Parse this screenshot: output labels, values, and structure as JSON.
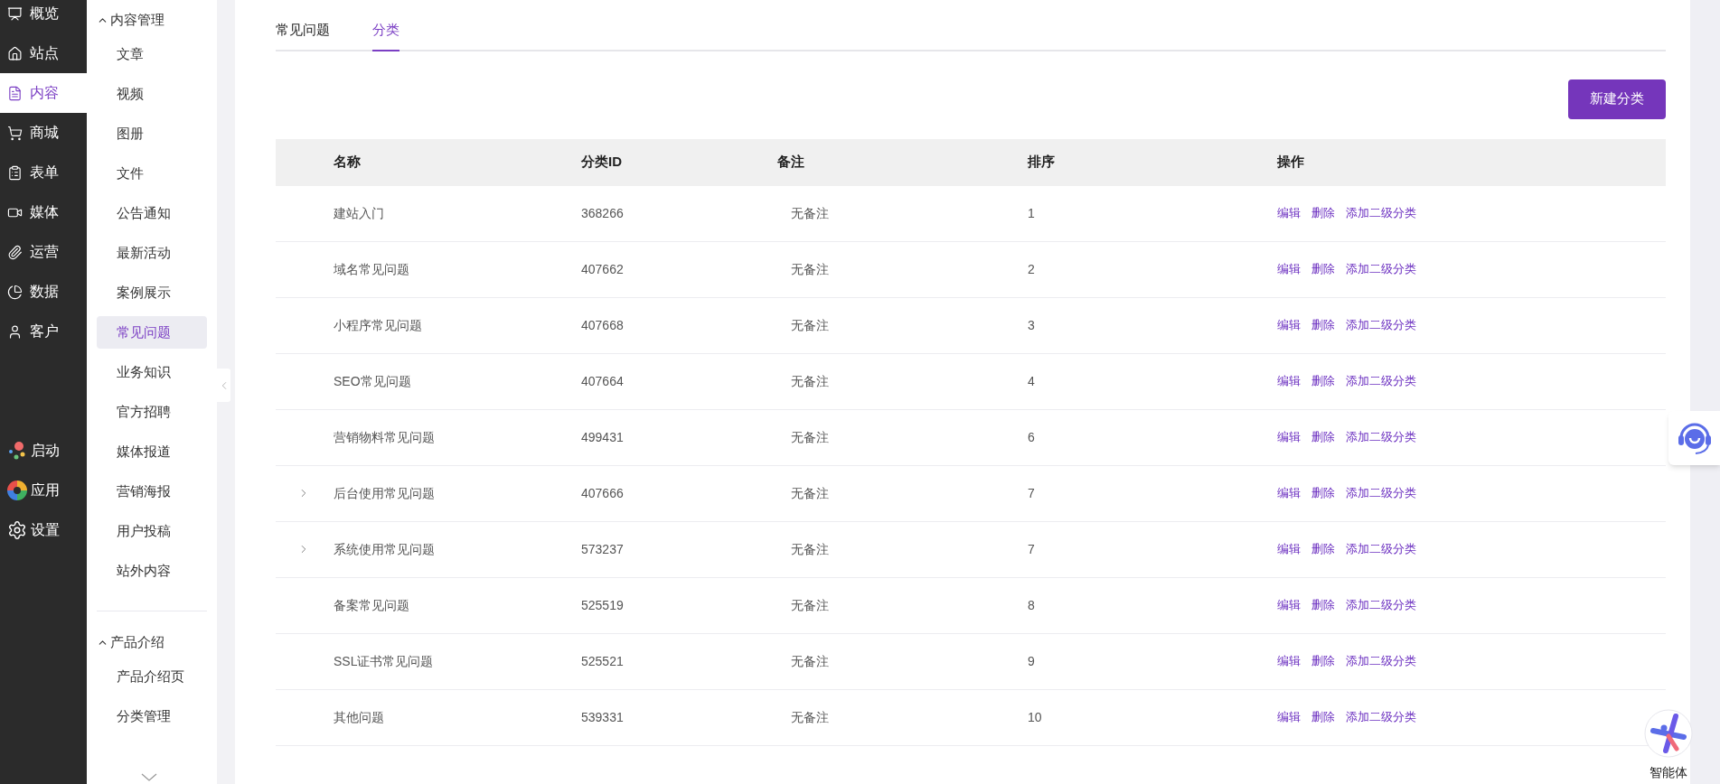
{
  "rail": {
    "main": [
      {
        "label": "概览",
        "selected": false
      },
      {
        "label": "站点",
        "selected": false
      },
      {
        "label": "内容",
        "selected": true
      },
      {
        "label": "商城",
        "selected": false
      },
      {
        "label": "表单",
        "selected": false
      },
      {
        "label": "媒体",
        "selected": false
      },
      {
        "label": "运营",
        "selected": false
      },
      {
        "label": "数据",
        "selected": false
      },
      {
        "label": "客户",
        "selected": false
      }
    ],
    "bottom": [
      {
        "label": "启动"
      },
      {
        "label": "应用"
      },
      {
        "label": "设置"
      }
    ]
  },
  "submenu": [
    {
      "title": "内容管理",
      "expanded": true,
      "items": [
        {
          "label": "文章",
          "selected": false
        },
        {
          "label": "视频",
          "selected": false
        },
        {
          "label": "图册",
          "selected": false
        },
        {
          "label": "文件",
          "selected": false
        },
        {
          "label": "公告通知",
          "selected": false
        },
        {
          "label": "最新活动",
          "selected": false
        },
        {
          "label": "案例展示",
          "selected": false
        },
        {
          "label": "常见问题",
          "selected": true
        },
        {
          "label": "业务知识",
          "selected": false
        },
        {
          "label": "官方招聘",
          "selected": false
        },
        {
          "label": "媒体报道",
          "selected": false
        },
        {
          "label": "营销海报",
          "selected": false
        },
        {
          "label": "用户投稿",
          "selected": false
        },
        {
          "label": "站外内容",
          "selected": false
        }
      ]
    },
    {
      "title": "产品介绍",
      "expanded": true,
      "items": [
        {
          "label": "产品介绍页",
          "selected": false
        },
        {
          "label": "分类管理",
          "selected": false
        }
      ]
    }
  ],
  "tabs": [
    {
      "label": "常见问题",
      "selected": false
    },
    {
      "label": "分类",
      "selected": true
    }
  ],
  "new_button": "新建分类",
  "table": {
    "columns": [
      "名称",
      "分类ID",
      "备注",
      "排序",
      "操作"
    ],
    "rows": [
      {
        "expandable": false,
        "name": "建站入门",
        "id": "368266",
        "note": "无备注",
        "order": "1",
        "actions": [
          "编辑",
          "删除",
          "添加二级分类"
        ]
      },
      {
        "expandable": false,
        "name": "域名常见问题",
        "id": "407662",
        "note": "无备注",
        "order": "2",
        "actions": [
          "编辑",
          "删除",
          "添加二级分类"
        ]
      },
      {
        "expandable": false,
        "name": "小程序常见问题",
        "id": "407668",
        "note": "无备注",
        "order": "3",
        "actions": [
          "编辑",
          "删除",
          "添加二级分类"
        ]
      },
      {
        "expandable": false,
        "name": "SEO常见问题",
        "id": "407664",
        "note": "无备注",
        "order": "4",
        "actions": [
          "编辑",
          "删除",
          "添加二级分类"
        ]
      },
      {
        "expandable": false,
        "name": "营销物料常见问题",
        "id": "499431",
        "note": "无备注",
        "order": "6",
        "actions": [
          "编辑",
          "删除",
          "添加二级分类"
        ]
      },
      {
        "expandable": true,
        "name": "后台使用常见问题",
        "id": "407666",
        "note": "无备注",
        "order": "7",
        "actions": [
          "编辑",
          "删除",
          "添加二级分类"
        ]
      },
      {
        "expandable": true,
        "name": "系统使用常见问题",
        "id": "573237",
        "note": "无备注",
        "order": "7",
        "actions": [
          "编辑",
          "删除",
          "添加二级分类"
        ]
      },
      {
        "expandable": false,
        "name": "备案常见问题",
        "id": "525519",
        "note": "无备注",
        "order": "8",
        "actions": [
          "编辑",
          "删除",
          "添加二级分类"
        ]
      },
      {
        "expandable": false,
        "name": "SSL证书常见问题",
        "id": "525521",
        "note": "无备注",
        "order": "9",
        "actions": [
          "编辑",
          "删除",
          "添加二级分类"
        ]
      },
      {
        "expandable": false,
        "name": "其他问题",
        "id": "539331",
        "note": "无备注",
        "order": "10",
        "actions": [
          "编辑",
          "删除",
          "添加二级分类"
        ]
      }
    ]
  },
  "agent_label": "智能体"
}
